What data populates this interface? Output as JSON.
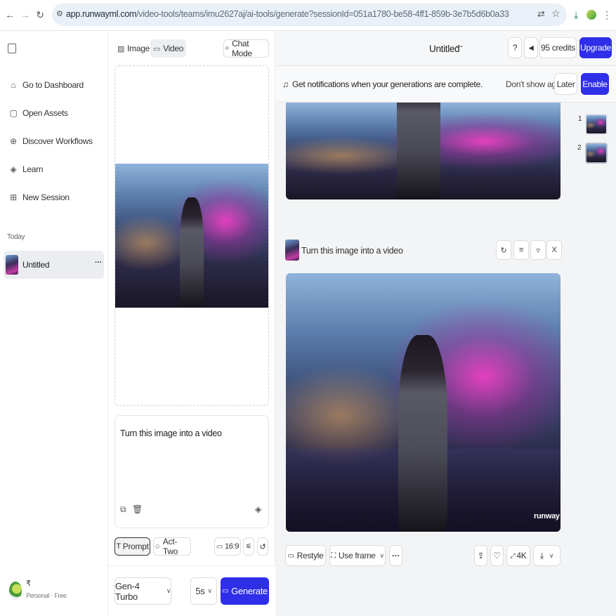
{
  "browser": {
    "url_main": "app.runwayml.com",
    "url_path": "/video-tools/teams/imu2627aj/ai-tools/generate?sessionId=051a1780-be58-4ff1-859b-3e7b5d6b0a33"
  },
  "sidebar": {
    "items": [
      {
        "label": "Go to Dashboard",
        "icon": "home-icon"
      },
      {
        "label": "Open Assets",
        "icon": "file-icon"
      },
      {
        "label": "Discover Workflows",
        "icon": "globe-icon"
      },
      {
        "label": "Learn",
        "icon": "graduation-cap-icon"
      },
      {
        "label": "New Session",
        "icon": "plus-square-icon"
      }
    ],
    "section_label": "Today",
    "session_title": "Untitled",
    "session_more": "···",
    "user_initial": "₹",
    "user_plan": "Personal · Free"
  },
  "mid": {
    "tab_image": "Image",
    "tab_video": "Video",
    "chat_mode": "Chat Mode",
    "prompt_text": "Turn this image into a video",
    "mode_prompt": "Prompt",
    "mode_acttwo": "Act-Two",
    "aspect": "16:9",
    "model": "Gen-4 Turbo",
    "duration": "5s",
    "generate": "Generate"
  },
  "top": {
    "title": "Untitled",
    "title_more": "···",
    "credits": "95 credits",
    "upgrade": "Upgrade"
  },
  "notification": {
    "text": "Get notifications when your generations are complete.",
    "dont_show": "Don't show again",
    "later": "Later",
    "enable": "Enable"
  },
  "generation": {
    "prompt": "Turn this image into a video",
    "close": "X",
    "watermark": "runway",
    "restyle": "Restyle",
    "use_frame": "Use frame",
    "more": "···",
    "upscale": "4K"
  },
  "thumbs": [
    "1",
    "2"
  ],
  "colors": {
    "accent": "#2f2ee8",
    "sidebar_active": "#ebedf0",
    "canvas_bg": "#f3f4f6"
  }
}
